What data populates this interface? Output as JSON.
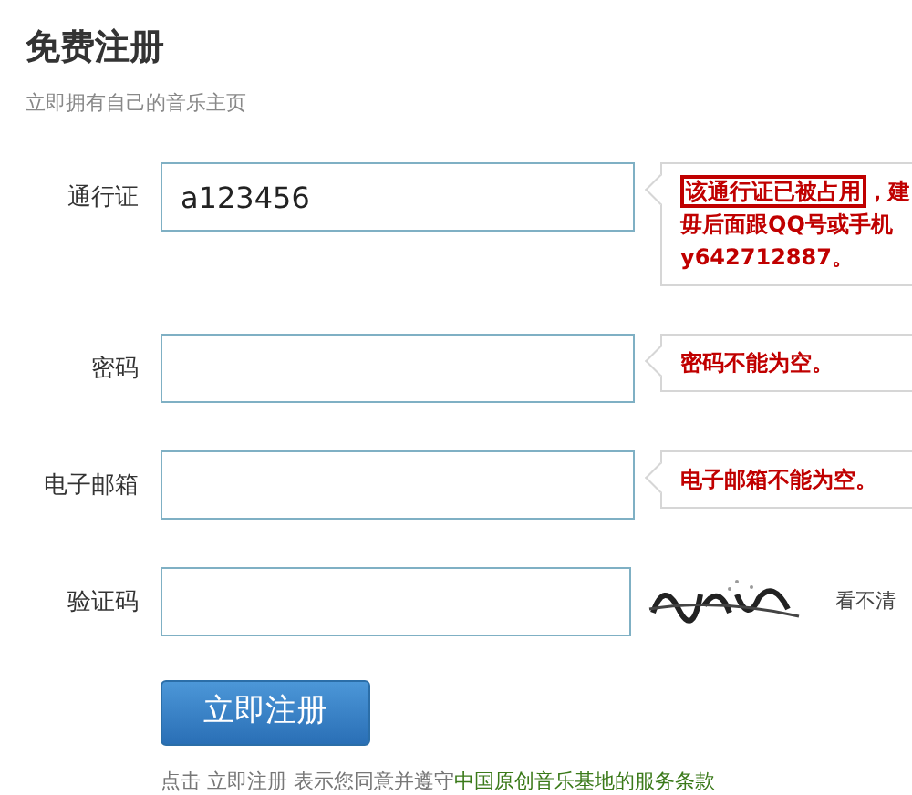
{
  "title": "免费注册",
  "subtitle": "立即拥有自己的音乐主页",
  "fields": [
    {
      "kind": "text",
      "label": "通行证",
      "value": "a123456",
      "error": {
        "boxed": "该通行证已被占用",
        "lines": [
          "，建",
          "毋后面跟QQ号或手机",
          "y642712887。"
        ]
      }
    },
    {
      "kind": "text",
      "label": "密码",
      "error": {
        "lines": [
          "密码不能为空。"
        ]
      }
    },
    {
      "kind": "text",
      "label": "电子邮箱",
      "error": {
        "lines": [
          "电子邮箱不能为空。"
        ]
      }
    },
    {
      "kind": "captcha",
      "label": "验证码",
      "refresh": "看不清"
    }
  ],
  "submit": "立即注册",
  "agreement": {
    "text": "点击 立即注册 表示您同意并遵守",
    "link": "中国原创音乐基地的服务条款"
  }
}
